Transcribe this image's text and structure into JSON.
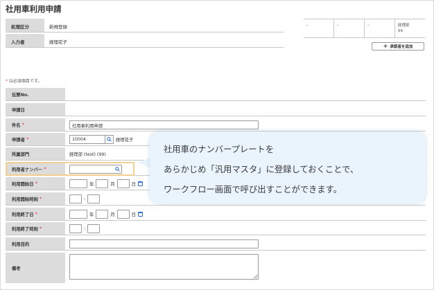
{
  "title": "社用車利用申請",
  "info": {
    "processing_label": "処理区分",
    "processing_value": "新規登録",
    "entrant_label": "入力者",
    "entrant_value": "経理花子"
  },
  "approvers": [
    {
      "line1": "–",
      "line2": ""
    },
    {
      "line1": "–",
      "line2": ""
    },
    {
      "line1": "–",
      "line2": ""
    },
    {
      "line1": "経理部",
      "line2": "99"
    }
  ],
  "add_approver_label": "承認者を追加",
  "required_note": "は必須項目です。",
  "required_mark": "*",
  "form": {
    "slip_no_label": "伝票No.",
    "apply_date_label": "申請日",
    "subject_label": "件名",
    "subject_value": "社用車利用申請",
    "applicant_label": "申請者",
    "applicant_code": "10004",
    "applicant_name": "経理花子",
    "dept_label": "所属部門",
    "dept_value": "経理部 (test) (99)",
    "car_number_label": "利用者ナンバー",
    "start_date_label": "利用開始日",
    "start_time_label": "利用開始時刻",
    "end_date_label": "利用終了日",
    "end_time_label": "利用終了時刻",
    "purpose_label": "利用目的",
    "remarks_label": "備考",
    "year": "年",
    "month": "月",
    "day": "日",
    "colon": ":"
  },
  "bubble": {
    "line1": "社用車のナンバープレートを",
    "line2": "あらかじめ「汎用マスタ」に登録しておくことで、",
    "line3": "ワークフロー画面で呼び出すことができます。"
  },
  "icons": {
    "search": "search-icon",
    "calendar": "calendar-icon",
    "plus": "plus-icon",
    "resize": "resize-handle-icon"
  },
  "colors": {
    "required": "#e04b5a",
    "label_bg": "#dcdcdc",
    "highlight": "#f4d08f",
    "bubble_bg": "#e8f4fc",
    "calendar": "#2f6fd6"
  }
}
